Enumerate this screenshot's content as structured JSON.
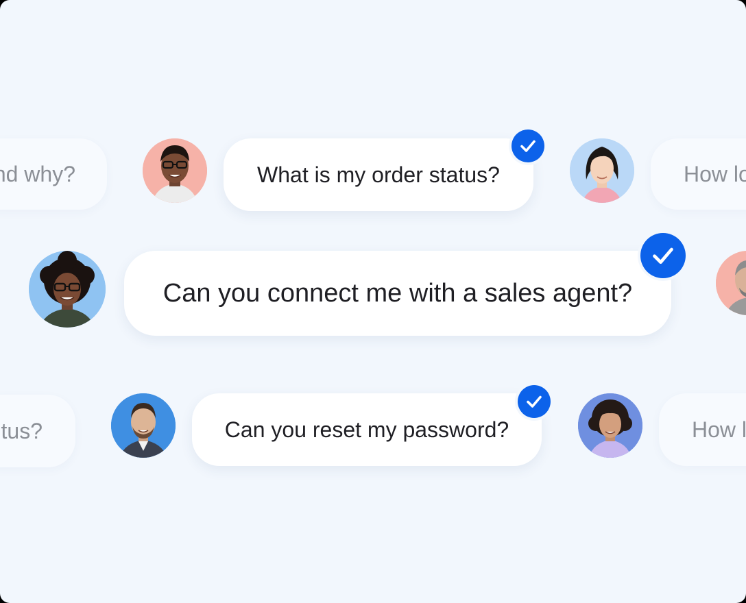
{
  "colors": {
    "background": "#f2f7fd",
    "bubble": "#ffffff",
    "check": "#0c62ea",
    "text": "#1f1f24",
    "faded_text": "#8b8f96"
  },
  "row1": {
    "left_partial": "nd why?",
    "main": "What is my order status?",
    "right_partial": "How lo"
  },
  "row2": {
    "main": "Can you connect me with a sales agent?"
  },
  "row3": {
    "left_partial": "tus?",
    "main": "Can you reset my password?",
    "right_partial": "How l"
  },
  "icons": {
    "check": "check-icon"
  }
}
